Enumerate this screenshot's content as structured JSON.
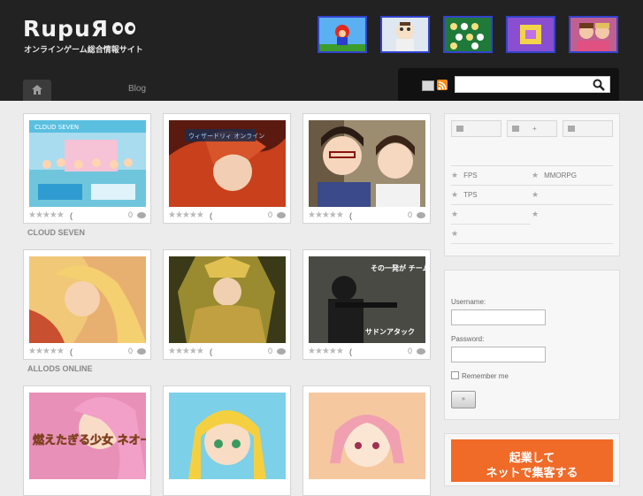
{
  "header": {
    "logo": "RupuЯ",
    "tagline": "オンラインゲーム総合情報サイト",
    "nav": {
      "blog_label": "Blog"
    },
    "search": {
      "placeholder": ""
    },
    "top_thumbs": [
      "mario-thumbnail",
      "cartoon-family-thumbnail",
      "board-game-thumbnail",
      "purple-puzzle-thumbnail",
      "girls-portrait-thumbnail"
    ]
  },
  "games": [
    {
      "title": "CLOUD SEVEN",
      "stars": "★★★★★",
      "paren": "(",
      "comments": "0"
    },
    {
      "title": "",
      "stars": "★★★★★",
      "paren": "(",
      "comments": "0"
    },
    {
      "title": "",
      "stars": "★★★★★",
      "paren": "(",
      "comments": "0"
    },
    {
      "title": "ALLODS ONLINE",
      "stars": "★★★★★",
      "paren": "(",
      "comments": "0"
    },
    {
      "title": "",
      "stars": "★★★★★",
      "paren": "(",
      "comments": "0"
    },
    {
      "title": "",
      "stars": "★★★★★",
      "paren": "(",
      "comments": "0"
    },
    {
      "title": "",
      "stars": "",
      "paren": "",
      "comments": ""
    },
    {
      "title": "",
      "stars": "",
      "paren": "",
      "comments": ""
    },
    {
      "title": "",
      "stars": "",
      "paren": "",
      "comments": ""
    }
  ],
  "card_texts": {
    "c0_banner": "CLOUD SEVEN",
    "c1_banner": "ウィザードリィ オンライン",
    "c5_banner": "その一発が チームの",
    "c5_logo": "サドンアタック",
    "c6_text": "燃えたぎる少女 ネオー国を開",
    "c7_text": "",
    "c8_text": ""
  },
  "sidebar": {
    "tabs": [
      {
        "label": ""
      },
      {
        "label": "+"
      },
      {
        "label": ""
      }
    ],
    "categories": [
      {
        "star": "★",
        "label": "FPS"
      },
      {
        "star": "★",
        "label": "MMORPG"
      },
      {
        "star": "★",
        "label": "TPS"
      },
      {
        "star": "★",
        "label": ""
      },
      {
        "star": "★",
        "label": ""
      },
      {
        "star": "★",
        "label": ""
      },
      {
        "star": "★",
        "label": ""
      }
    ],
    "login": {
      "username_label": "Username:",
      "password_label": "Password:",
      "remember_label": "Remember me",
      "button_label": "»"
    },
    "ad": {
      "line1": "起業して",
      "line2": "ネットで集客する"
    }
  },
  "colors": {
    "header_bg": "#222222",
    "thumb_border": "#3344cc",
    "ad_bg": "#f06a28"
  }
}
